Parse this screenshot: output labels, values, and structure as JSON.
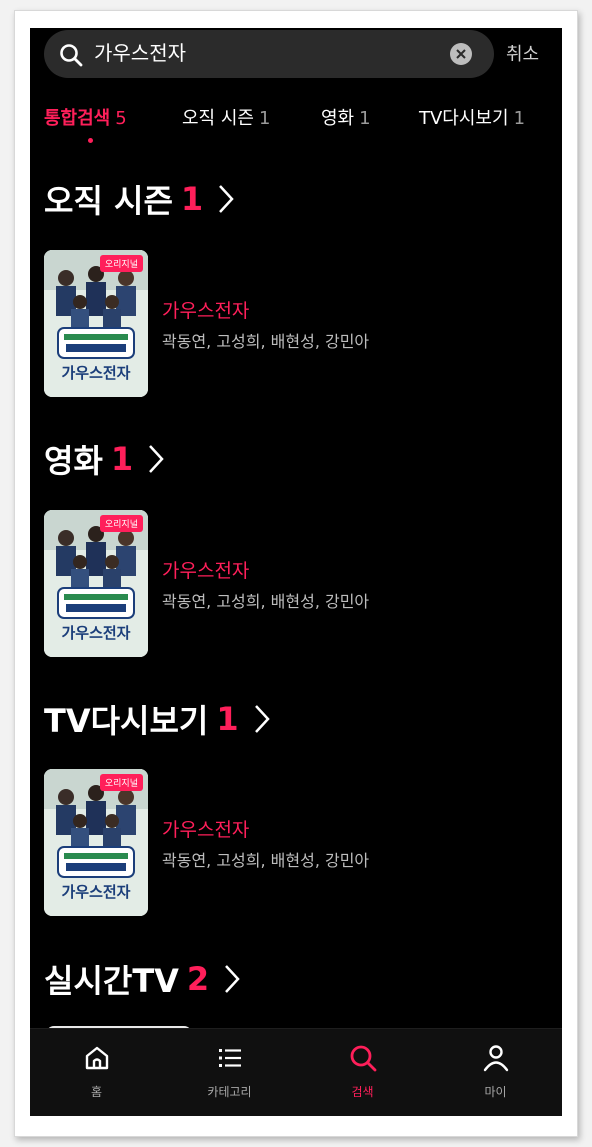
{
  "search": {
    "query": "가우스전자",
    "cancel_label": "취소"
  },
  "tabs": [
    {
      "label": "통합검색",
      "count": "5",
      "active": true
    },
    {
      "label": "오직 시즌",
      "count": "1"
    },
    {
      "label": "영화",
      "count": "1"
    },
    {
      "label": "TV다시보기",
      "count": "1"
    }
  ],
  "sections": [
    {
      "title": "오직 시즌",
      "count": "1",
      "item": {
        "badge": "오리지널",
        "poster_caption": "가우스전자",
        "title": "가우스전자",
        "cast": "곽동연, 고성희, 배현성, 강민아"
      }
    },
    {
      "title": "영화",
      "count": "1",
      "item": {
        "badge": "오리지널",
        "poster_caption": "가우스전자",
        "title": "가우스전자",
        "cast": "곽동연, 고성희, 배현성, 강민아"
      }
    },
    {
      "title": "TV다시보기",
      "count": "1",
      "item": {
        "badge": "오리지널",
        "poster_caption": "가우스전자",
        "title": "가우스전자",
        "cast": "곽동연, 고성희, 배현성, 강민아"
      }
    },
    {
      "title": "실시간TV",
      "count": "2"
    }
  ],
  "bottom_nav": [
    {
      "label": "홈",
      "icon": "home-icon"
    },
    {
      "label": "카테고리",
      "icon": "list-icon"
    },
    {
      "label": "검색",
      "icon": "search-icon",
      "active": true
    },
    {
      "label": "마이",
      "icon": "person-icon"
    }
  ],
  "colors": {
    "accent": "#ff1f5a",
    "background": "#000000",
    "search_bg": "#2b2b2b",
    "secondary_text": "#bdbdbd"
  }
}
